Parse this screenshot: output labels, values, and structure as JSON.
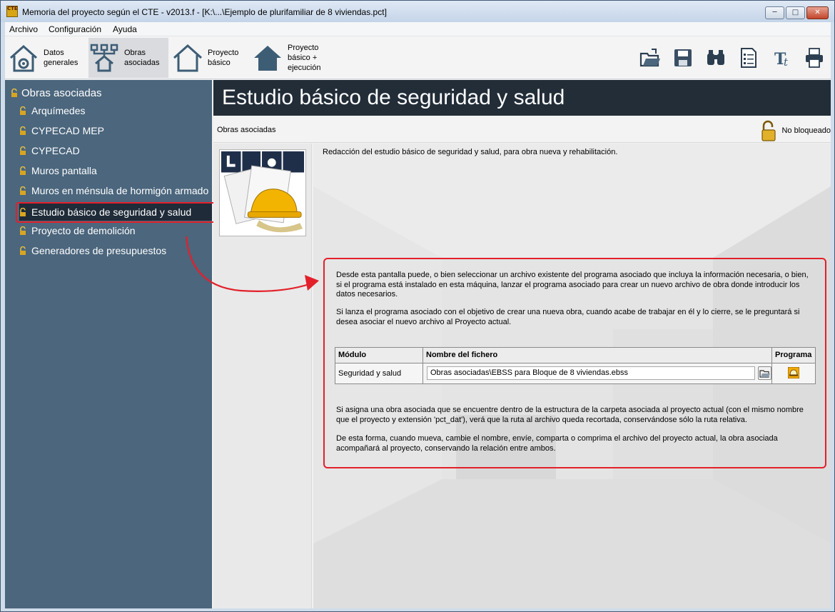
{
  "window": {
    "title": "Memoria del proyecto según el CTE - v2013.f - [K:\\...\\Ejemplo de plurifamiliar de 8 viviendas.pct]",
    "app_icon_text": "CTE",
    "minimize": "─",
    "maximize": "□",
    "close": "✕"
  },
  "menu": [
    "Archivo",
    "Configuración",
    "Ayuda"
  ],
  "toolbar": {
    "buttons": [
      {
        "label": "Datos\ngenerales",
        "icon": "house-gear-icon"
      },
      {
        "label": "Obras\nasociadas",
        "icon": "hierarchy-house-icon",
        "active": true
      },
      {
        "label": "Proyecto\nbásico",
        "icon": "house-outline-icon"
      },
      {
        "label": "Proyecto\nbásico +\nejecución",
        "icon": "house-filled-icon"
      }
    ],
    "right_icons": [
      "open-folder-icon",
      "save-icon",
      "binoculars-icon",
      "checklist-icon",
      "text-format-icon",
      "print-icon"
    ]
  },
  "sidebar": {
    "root": "Obras asociadas",
    "items": [
      "Arquímedes",
      "CYPECAD MEP",
      "CYPECAD",
      "Muros pantalla",
      "Muros en ménsula de hormigón armado",
      "Estudio básico de seguridad y salud",
      "Proyecto de demolición",
      "Generadores de presupuestos"
    ],
    "selected_index": 5
  },
  "main": {
    "title": "Estudio básico de seguridad y salud",
    "breadcrumb": "Obras asociadas",
    "lock_status": "No bloqueado",
    "description": "Redacción del estudio básico de seguridad y salud, para obra nueva y rehabilitación.",
    "info": {
      "p1": "Desde esta pantalla puede, o bien seleccionar un archivo existente del programa asociado que incluya la información necesaria, o bien, si el programa está instalado en esta máquina, lanzar el programa asociado para crear un nuevo archivo de obra donde introducir los datos necesarios.",
      "p2": "Si lanza el programa asociado con el objetivo de crear una nueva obra, cuando acabe de trabajar en él y lo cierre, se le preguntará si desea asociar el nuevo archivo al Proyecto actual.",
      "p3": "Si asigna una obra asociada que se encuentre dentro de la estructura de la carpeta asociada al proyecto actual (con el mismo nombre que el proyecto y extensión 'pct_dat'), verá que la ruta al archivo queda recortada, conservándose sólo la ruta relativa.",
      "p4": "De esta forma, cuando mueva, cambie el nombre, envíe, comparta o comprima el archivo del proyecto actual, la obra asociada acompañará al proyecto, conservando la relación entre ambos."
    },
    "table": {
      "headers": [
        "Módulo",
        "Nombre del fichero",
        "Programa"
      ],
      "row": {
        "module": "Seguridad y salud",
        "file": "Obras asociadas\\EBSS para Bloque de 8 viviendas.ebss"
      }
    }
  },
  "colors": {
    "sidebar_bg": "#4b667d",
    "header_bg": "#222d38",
    "highlight": "#e3202a"
  }
}
